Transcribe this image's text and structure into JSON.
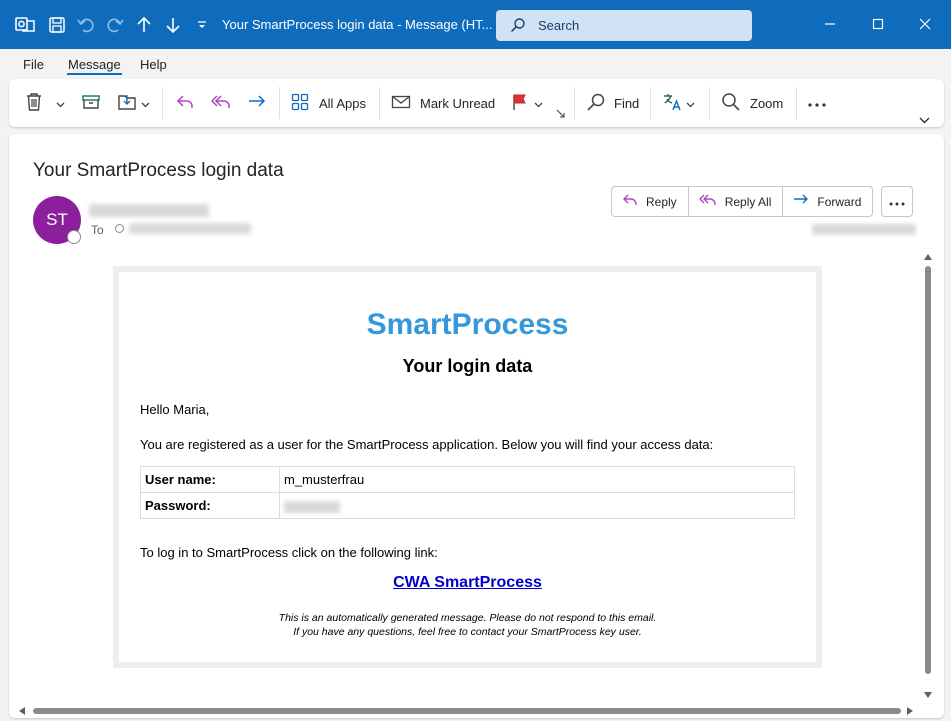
{
  "titlebar": {
    "title": "Your SmartProcess login data  -  Message (HT...",
    "search_placeholder": "Search"
  },
  "menu": {
    "file": "File",
    "message": "Message",
    "help": "Help"
  },
  "ribbon": {
    "all_apps": "All Apps",
    "mark_unread": "Mark Unread",
    "find": "Find",
    "zoom": "Zoom"
  },
  "message": {
    "subject": "Your SmartProcess login data",
    "avatar_initials": "ST",
    "to_label": "To",
    "reply": "Reply",
    "reply_all": "Reply All",
    "forward": "Forward"
  },
  "body": {
    "brand": "SmartProcess",
    "heading": "Your login data",
    "greeting": "Hello Maria,",
    "intro": "You are registered as a user for the SmartProcess application. Below you will find your access data:",
    "username_label": "User name:",
    "username_value": "m_musterfrau",
    "password_label": "Password:",
    "login_text": "To log in to SmartProcess click on the following link:",
    "link_text": "CWA SmartProcess",
    "footer_line1": "This is an automatically generated message. Please do not respond to this email.",
    "footer_line2": "If you have any questions, feel free to contact your SmartProcess key user."
  },
  "colors": {
    "titlebar": "#0f6cbd",
    "avatar": "#8b1f9c",
    "brand": "#3498db",
    "link": "#0000cc"
  }
}
